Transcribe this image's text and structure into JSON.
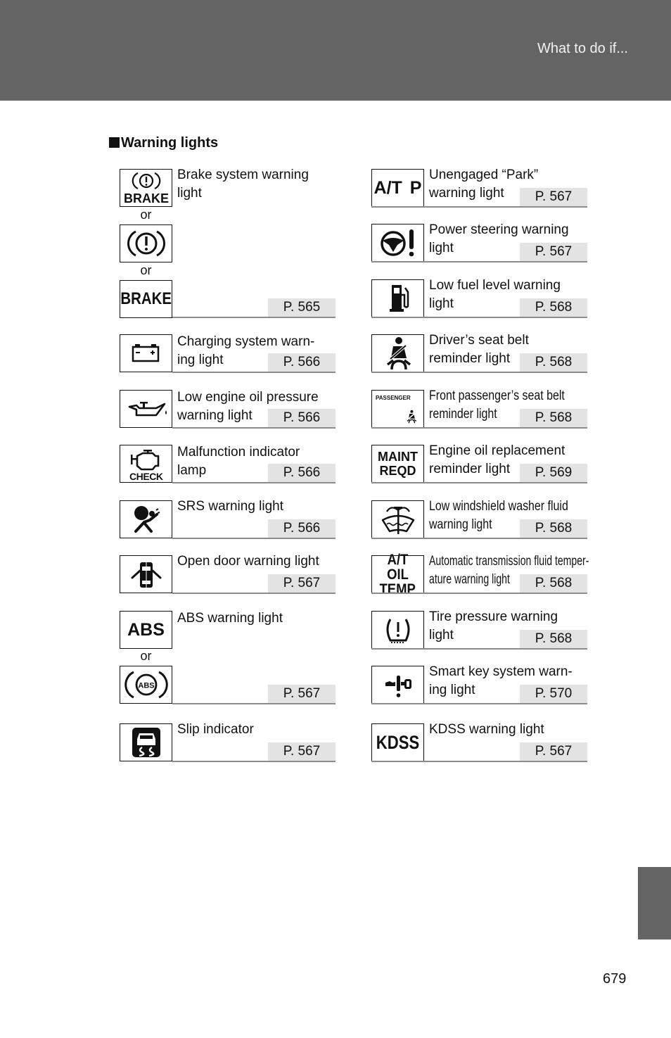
{
  "header": {
    "title": "What to do if..."
  },
  "section": {
    "title": "Warning lights"
  },
  "or_label": "or",
  "left_column": [
    {
      "name": "brake-system",
      "label_lines": [
        "Brake system warning",
        "light"
      ],
      "page": "P. 565",
      "icons": [
        "brake-text-circle-icon",
        "brake-circle-icon",
        "brake-text-icon"
      ],
      "icon_texts": [
        "BRAKE",
        "",
        "BRAKE"
      ]
    },
    {
      "name": "charging-system",
      "label_lines": [
        "Charging system warn-",
        "ing light"
      ],
      "page": "P. 566",
      "icons": [
        "battery-icon"
      ]
    },
    {
      "name": "low-oil-pressure",
      "label_lines": [
        "Low engine oil pressure",
        "warning light"
      ],
      "page": "P. 566",
      "icons": [
        "oil-can-icon"
      ]
    },
    {
      "name": "malfunction-indicator",
      "label_lines": [
        "Malfunction indicator",
        "lamp"
      ],
      "page": "P. 566",
      "icons": [
        "check-engine-icon"
      ],
      "icon_texts": [
        "CHECK"
      ]
    },
    {
      "name": "srs",
      "label_lines": [
        "SRS warning light",
        ""
      ],
      "page": "P. 566",
      "icons": [
        "airbag-icon"
      ]
    },
    {
      "name": "open-door",
      "label_lines": [
        "Open door warning light",
        ""
      ],
      "page": "P. 567",
      "icons": [
        "open-door-icon"
      ]
    },
    {
      "name": "abs",
      "label_lines": [
        "ABS warning light",
        ""
      ],
      "page": "P. 567",
      "icons": [
        "abs-text-icon",
        "abs-circle-icon"
      ],
      "icon_texts": [
        "ABS",
        "ABS"
      ]
    },
    {
      "name": "slip-indicator",
      "label_lines": [
        "Slip indicator",
        ""
      ],
      "page": "P. 567",
      "icons": [
        "slip-car-icon"
      ]
    }
  ],
  "right_column": [
    {
      "name": "unengaged-park",
      "label_lines": [
        "Unengaged “Park”",
        "warning light"
      ],
      "page": "P. 567",
      "icons": [
        "at-p-icon"
      ],
      "icon_texts": [
        "A/T P"
      ]
    },
    {
      "name": "power-steering",
      "label_lines": [
        "Power steering warning",
        "light"
      ],
      "page": "P. 567",
      "icons": [
        "steering-wheel-warning-icon"
      ]
    },
    {
      "name": "low-fuel",
      "label_lines": [
        "Low fuel level warning",
        "light"
      ],
      "page": "P. 568",
      "icons": [
        "fuel-pump-icon"
      ]
    },
    {
      "name": "driver-seat-belt",
      "label_lines": [
        "Driver’s seat belt",
        "reminder light"
      ],
      "page": "P. 568",
      "icons": [
        "seat-belt-icon"
      ]
    },
    {
      "name": "passenger-seat-belt",
      "label_lines": [
        "Front passenger’s seat belt",
        "reminder light"
      ],
      "page": "P. 568",
      "icons": [
        "passenger-seat-belt-icon"
      ],
      "icon_texts": [
        "PASSENGER"
      ]
    },
    {
      "name": "engine-oil-replacement",
      "label_lines": [
        "Engine oil replacement",
        "reminder light"
      ],
      "page": "P. 569",
      "icons": [
        "maint-reqd-icon"
      ],
      "icon_texts": [
        "MAINT",
        "REQD"
      ]
    },
    {
      "name": "low-washer-fluid",
      "label_lines": [
        "Low windshield washer fluid",
        "warning light"
      ],
      "page": "P. 568",
      "icons": [
        "washer-fluid-icon"
      ]
    },
    {
      "name": "at-fluid-temp",
      "label_lines": [
        "Automatic transmission fluid temper-",
        "ature warning light"
      ],
      "page": "P. 568",
      "icons": [
        "at-oil-temp-icon"
      ],
      "icon_texts": [
        "A/T OIL",
        "TEMP"
      ]
    },
    {
      "name": "tire-pressure",
      "label_lines": [
        "Tire pressure warning",
        "light"
      ],
      "page": "P. 568",
      "icons": [
        "tire-pressure-icon"
      ]
    },
    {
      "name": "smart-key",
      "label_lines": [
        "Smart key system warn-",
        "ing light"
      ],
      "page": "P. 570",
      "icons": [
        "smart-key-icon"
      ]
    },
    {
      "name": "kdss",
      "label_lines": [
        "KDSS warning light",
        ""
      ],
      "page": "P. 567",
      "icons": [
        "kdss-icon"
      ],
      "icon_texts": [
        "KDSS"
      ]
    }
  ],
  "footer": {
    "page_number": "679"
  }
}
